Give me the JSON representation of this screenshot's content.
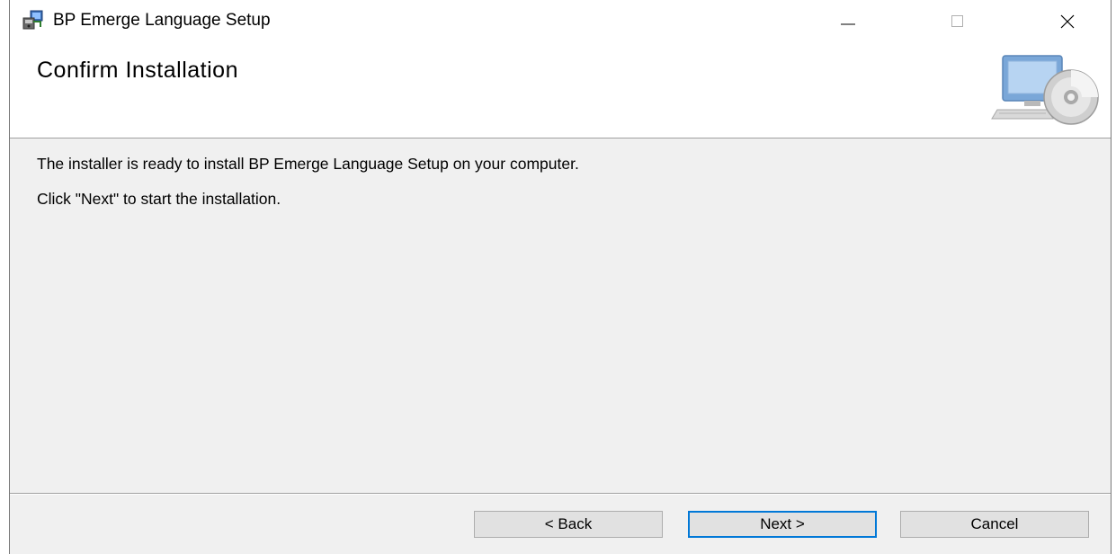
{
  "window": {
    "title": "BP Emerge Language Setup",
    "controls": {
      "minimize_icon": "minimize-icon",
      "maximize_icon": "maximize-icon",
      "close_icon": "close-icon"
    }
  },
  "header": {
    "title": "Confirm Installation",
    "graphic": "computer-cd-icon"
  },
  "content": {
    "line1": "The installer is ready to install BP Emerge Language Setup on your computer.",
    "line2": "Click \"Next\" to start the installation."
  },
  "buttons": {
    "back": "< Back",
    "next": "Next >",
    "cancel": "Cancel"
  },
  "colors": {
    "window_bg": "#f0f0f0",
    "header_bg": "#ffffff",
    "default_button_border": "#0078d7"
  }
}
